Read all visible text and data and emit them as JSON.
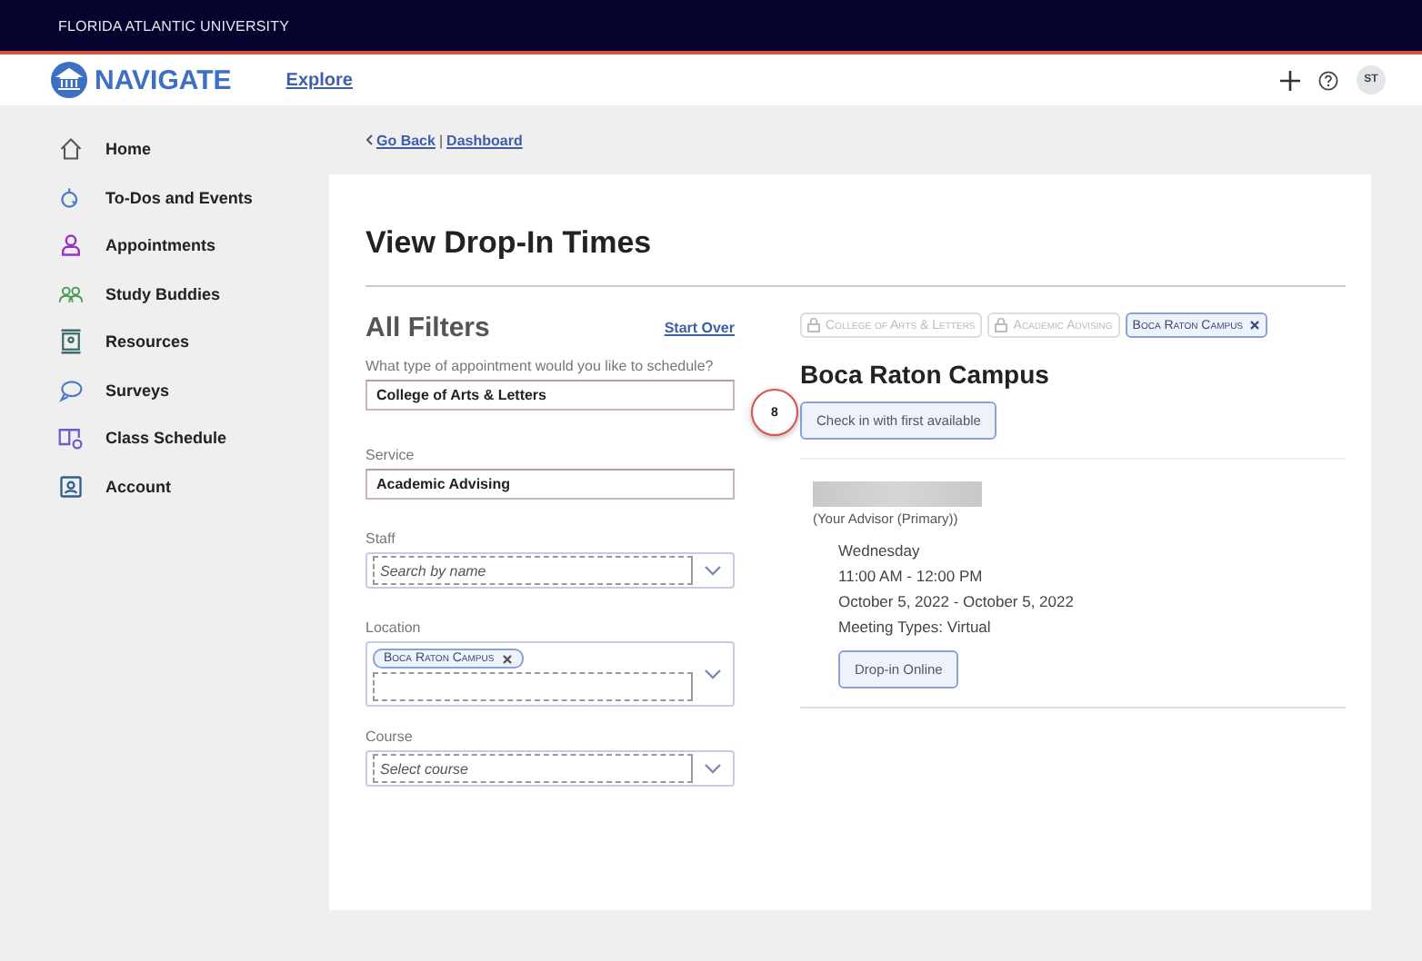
{
  "top_bar": {
    "university": "FLORIDA ATLANTIC UNIVERSITY"
  },
  "header": {
    "brand": "NAVIGATE",
    "nav_link": "Explore",
    "avatar": "ST"
  },
  "sidebar": {
    "items": [
      {
        "label": "Home",
        "selected": false
      },
      {
        "label": "To-Dos and Events",
        "selected": false
      },
      {
        "label": "Appointments",
        "selected": false
      },
      {
        "label": "Study Buddies",
        "selected": false
      },
      {
        "label": "Resources",
        "selected": false
      },
      {
        "label": "Surveys",
        "selected": false
      },
      {
        "label": "Class Schedule",
        "selected": false
      },
      {
        "label": "Account",
        "selected": false
      }
    ]
  },
  "breadcrumb": {
    "back": "Go Back",
    "separator": "|",
    "current": "Dashboard"
  },
  "page_title": "View Drop-In Times",
  "filters": {
    "title": "All Filters",
    "reset": "Start Over",
    "fields": [
      {
        "kind": "text",
        "label": "What type of appointment would you like to schedule?",
        "value": "College of Arts & Letters"
      },
      {
        "kind": "text",
        "label": "Service",
        "value": "Academic Advising"
      },
      {
        "kind": "select",
        "label": "Staff",
        "placeholder": "Search by name"
      },
      {
        "kind": "tags",
        "label": "Location",
        "tags": [
          "Boca Raton Campus"
        ]
      },
      {
        "kind": "select",
        "label": "Course",
        "placeholder": "Select course"
      }
    ]
  },
  "chips": [
    {
      "label": "College of Arts & Letters",
      "locked": true
    },
    {
      "label": "Academic Advising",
      "locked": true
    },
    {
      "label": "Boca Raton Campus",
      "locked": false
    }
  ],
  "results": {
    "location": "Boca Raton Campus",
    "check_in": "Check in with first available",
    "step_marker": "8",
    "slots": [
      {
        "role": "(Your Advisor (Primary))",
        "day": "Wednesday",
        "time": "11:00 AM - 12:00 PM",
        "dates": "October 5, 2022 - October 5, 2022",
        "meeting_types": "Meeting Types: Virtual",
        "action": "Drop-in Online"
      }
    ]
  }
}
